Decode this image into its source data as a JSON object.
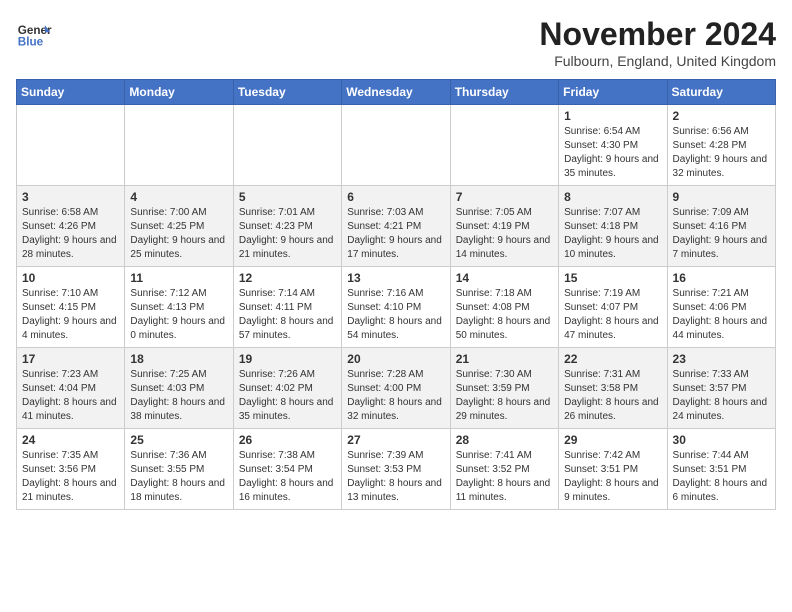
{
  "header": {
    "logo_line1": "General",
    "logo_line2": "Blue",
    "month": "November 2024",
    "location": "Fulbourn, England, United Kingdom"
  },
  "days_of_week": [
    "Sunday",
    "Monday",
    "Tuesday",
    "Wednesday",
    "Thursday",
    "Friday",
    "Saturday"
  ],
  "weeks": [
    [
      {
        "day": "",
        "info": ""
      },
      {
        "day": "",
        "info": ""
      },
      {
        "day": "",
        "info": ""
      },
      {
        "day": "",
        "info": ""
      },
      {
        "day": "",
        "info": ""
      },
      {
        "day": "1",
        "info": "Sunrise: 6:54 AM\nSunset: 4:30 PM\nDaylight: 9 hours and 35 minutes."
      },
      {
        "day": "2",
        "info": "Sunrise: 6:56 AM\nSunset: 4:28 PM\nDaylight: 9 hours and 32 minutes."
      }
    ],
    [
      {
        "day": "3",
        "info": "Sunrise: 6:58 AM\nSunset: 4:26 PM\nDaylight: 9 hours and 28 minutes."
      },
      {
        "day": "4",
        "info": "Sunrise: 7:00 AM\nSunset: 4:25 PM\nDaylight: 9 hours and 25 minutes."
      },
      {
        "day": "5",
        "info": "Sunrise: 7:01 AM\nSunset: 4:23 PM\nDaylight: 9 hours and 21 minutes."
      },
      {
        "day": "6",
        "info": "Sunrise: 7:03 AM\nSunset: 4:21 PM\nDaylight: 9 hours and 17 minutes."
      },
      {
        "day": "7",
        "info": "Sunrise: 7:05 AM\nSunset: 4:19 PM\nDaylight: 9 hours and 14 minutes."
      },
      {
        "day": "8",
        "info": "Sunrise: 7:07 AM\nSunset: 4:18 PM\nDaylight: 9 hours and 10 minutes."
      },
      {
        "day": "9",
        "info": "Sunrise: 7:09 AM\nSunset: 4:16 PM\nDaylight: 9 hours and 7 minutes."
      }
    ],
    [
      {
        "day": "10",
        "info": "Sunrise: 7:10 AM\nSunset: 4:15 PM\nDaylight: 9 hours and 4 minutes."
      },
      {
        "day": "11",
        "info": "Sunrise: 7:12 AM\nSunset: 4:13 PM\nDaylight: 9 hours and 0 minutes."
      },
      {
        "day": "12",
        "info": "Sunrise: 7:14 AM\nSunset: 4:11 PM\nDaylight: 8 hours and 57 minutes."
      },
      {
        "day": "13",
        "info": "Sunrise: 7:16 AM\nSunset: 4:10 PM\nDaylight: 8 hours and 54 minutes."
      },
      {
        "day": "14",
        "info": "Sunrise: 7:18 AM\nSunset: 4:08 PM\nDaylight: 8 hours and 50 minutes."
      },
      {
        "day": "15",
        "info": "Sunrise: 7:19 AM\nSunset: 4:07 PM\nDaylight: 8 hours and 47 minutes."
      },
      {
        "day": "16",
        "info": "Sunrise: 7:21 AM\nSunset: 4:06 PM\nDaylight: 8 hours and 44 minutes."
      }
    ],
    [
      {
        "day": "17",
        "info": "Sunrise: 7:23 AM\nSunset: 4:04 PM\nDaylight: 8 hours and 41 minutes."
      },
      {
        "day": "18",
        "info": "Sunrise: 7:25 AM\nSunset: 4:03 PM\nDaylight: 8 hours and 38 minutes."
      },
      {
        "day": "19",
        "info": "Sunrise: 7:26 AM\nSunset: 4:02 PM\nDaylight: 8 hours and 35 minutes."
      },
      {
        "day": "20",
        "info": "Sunrise: 7:28 AM\nSunset: 4:00 PM\nDaylight: 8 hours and 32 minutes."
      },
      {
        "day": "21",
        "info": "Sunrise: 7:30 AM\nSunset: 3:59 PM\nDaylight: 8 hours and 29 minutes."
      },
      {
        "day": "22",
        "info": "Sunrise: 7:31 AM\nSunset: 3:58 PM\nDaylight: 8 hours and 26 minutes."
      },
      {
        "day": "23",
        "info": "Sunrise: 7:33 AM\nSunset: 3:57 PM\nDaylight: 8 hours and 24 minutes."
      }
    ],
    [
      {
        "day": "24",
        "info": "Sunrise: 7:35 AM\nSunset: 3:56 PM\nDaylight: 8 hours and 21 minutes."
      },
      {
        "day": "25",
        "info": "Sunrise: 7:36 AM\nSunset: 3:55 PM\nDaylight: 8 hours and 18 minutes."
      },
      {
        "day": "26",
        "info": "Sunrise: 7:38 AM\nSunset: 3:54 PM\nDaylight: 8 hours and 16 minutes."
      },
      {
        "day": "27",
        "info": "Sunrise: 7:39 AM\nSunset: 3:53 PM\nDaylight: 8 hours and 13 minutes."
      },
      {
        "day": "28",
        "info": "Sunrise: 7:41 AM\nSunset: 3:52 PM\nDaylight: 8 hours and 11 minutes."
      },
      {
        "day": "29",
        "info": "Sunrise: 7:42 AM\nSunset: 3:51 PM\nDaylight: 8 hours and 9 minutes."
      },
      {
        "day": "30",
        "info": "Sunrise: 7:44 AM\nSunset: 3:51 PM\nDaylight: 8 hours and 6 minutes."
      }
    ]
  ]
}
